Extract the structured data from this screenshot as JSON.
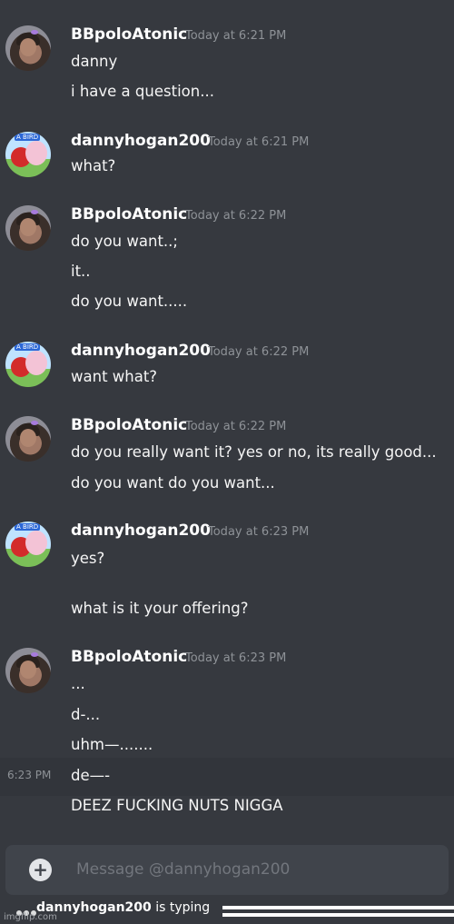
{
  "chat": {
    "groups": [
      {
        "user": "BBpoloAtonic",
        "timestamp": "Today at 6:21 PM",
        "avatar": "person-avatar",
        "messages": [
          "danny",
          "i have a question..."
        ]
      },
      {
        "user": "dannyhogan200",
        "timestamp": "Today at 6:21 PM",
        "avatar": "angry-birds-avatar",
        "messages": [
          "what?"
        ]
      },
      {
        "user": "BBpoloAtonic",
        "timestamp": "Today at 6:22 PM",
        "avatar": "person-avatar",
        "messages": [
          "do you want..;",
          "it..",
          "do you want....."
        ]
      },
      {
        "user": "dannyhogan200",
        "timestamp": "Today at 6:22 PM",
        "avatar": "angry-birds-avatar",
        "messages": [
          "want what?"
        ]
      },
      {
        "user": "BBpoloAtonic",
        "timestamp": "Today at 6:22 PM",
        "avatar": "person-avatar",
        "messages": [
          "do you really want it? yes or no, its really good...",
          "do you want do you want..."
        ]
      },
      {
        "user": "dannyhogan200",
        "timestamp": "Today at 6:23 PM",
        "avatar": "angry-birds-avatar",
        "messages": [
          "yes?",
          "what is it your offering?"
        ]
      },
      {
        "user": "BBpoloAtonic",
        "timestamp": "Today at 6:23 PM",
        "avatar": "person-avatar",
        "messages": [
          "...",
          "d-...",
          "uhm—.......",
          "de—-",
          "DEEZ FUCKING NUTS NIGGA"
        ]
      }
    ],
    "hover_time": "6:23 PM"
  },
  "composer": {
    "plus_icon": "+",
    "placeholder": "Message @dannyhogan200"
  },
  "typing_indicator": {
    "user": "dannyhogan200",
    "suffix": " is typing"
  },
  "watermark": "imgflip.com",
  "bird_badge": "A BIRD"
}
